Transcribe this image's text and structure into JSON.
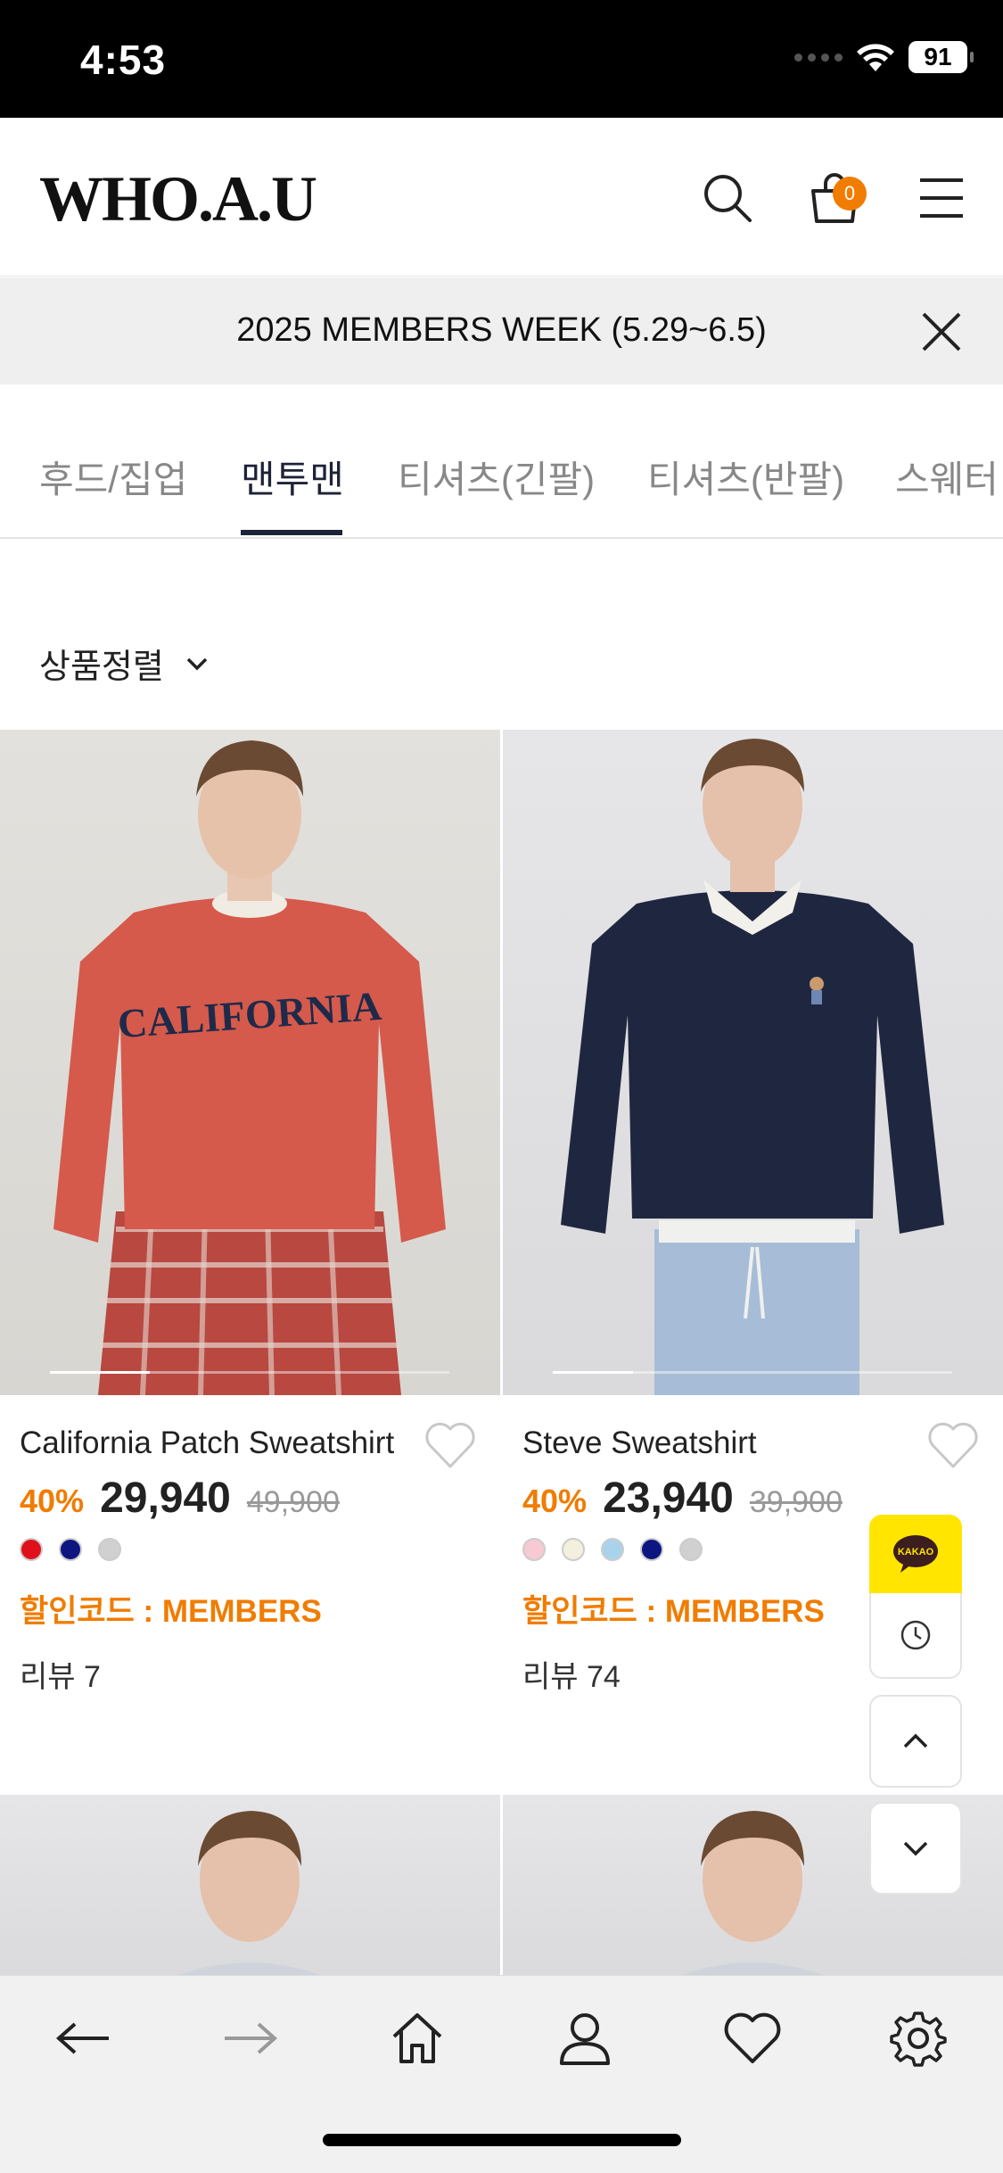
{
  "status_bar": {
    "time": "4:53",
    "battery": "91"
  },
  "header": {
    "logo": "WHO.A.U",
    "cart_count": "0"
  },
  "banner": {
    "text": "2025 MEMBERS WEEK (5.29~6.5)"
  },
  "tabs": [
    {
      "label": "후드/집업",
      "active": false
    },
    {
      "label": "맨투맨",
      "active": true
    },
    {
      "label": "티셔츠(긴팔)",
      "active": false
    },
    {
      "label": "티셔츠(반팔)",
      "active": false
    },
    {
      "label": "스웨터",
      "active": false
    }
  ],
  "sort": {
    "label": "상품정렬"
  },
  "products": [
    {
      "name": "California Patch Sweatshirt",
      "discount": "40%",
      "price": "29,940",
      "original_price": "49,900",
      "colors": [
        "#e0101a",
        "#0d1680",
        "#d0d0d0"
      ],
      "coupon": "할인코드 : MEMBERS",
      "review": "리뷰 7",
      "image": {
        "sweatshirt_color": "#d55a4b",
        "print_text": "CALIFORNIA",
        "image_position": 0.0
      }
    },
    {
      "name": "Steve Sweatshirt",
      "discount": "40%",
      "price": "23,940",
      "original_price": "39,900",
      "colors": [
        "#f7c9d2",
        "#f3f0de",
        "#a9d3ec",
        "#0d1680",
        "#d0d0d0"
      ],
      "coupon": "할인코드 : MEMBERS",
      "review": "리뷰 74",
      "image": {
        "sweatshirt_color": "#1f2740",
        "image_position": 0.0
      }
    }
  ],
  "floating": {
    "kakao_label": "KAKAO"
  },
  "colors": {
    "accent": "#f07c00",
    "navy": "#1d2236"
  }
}
